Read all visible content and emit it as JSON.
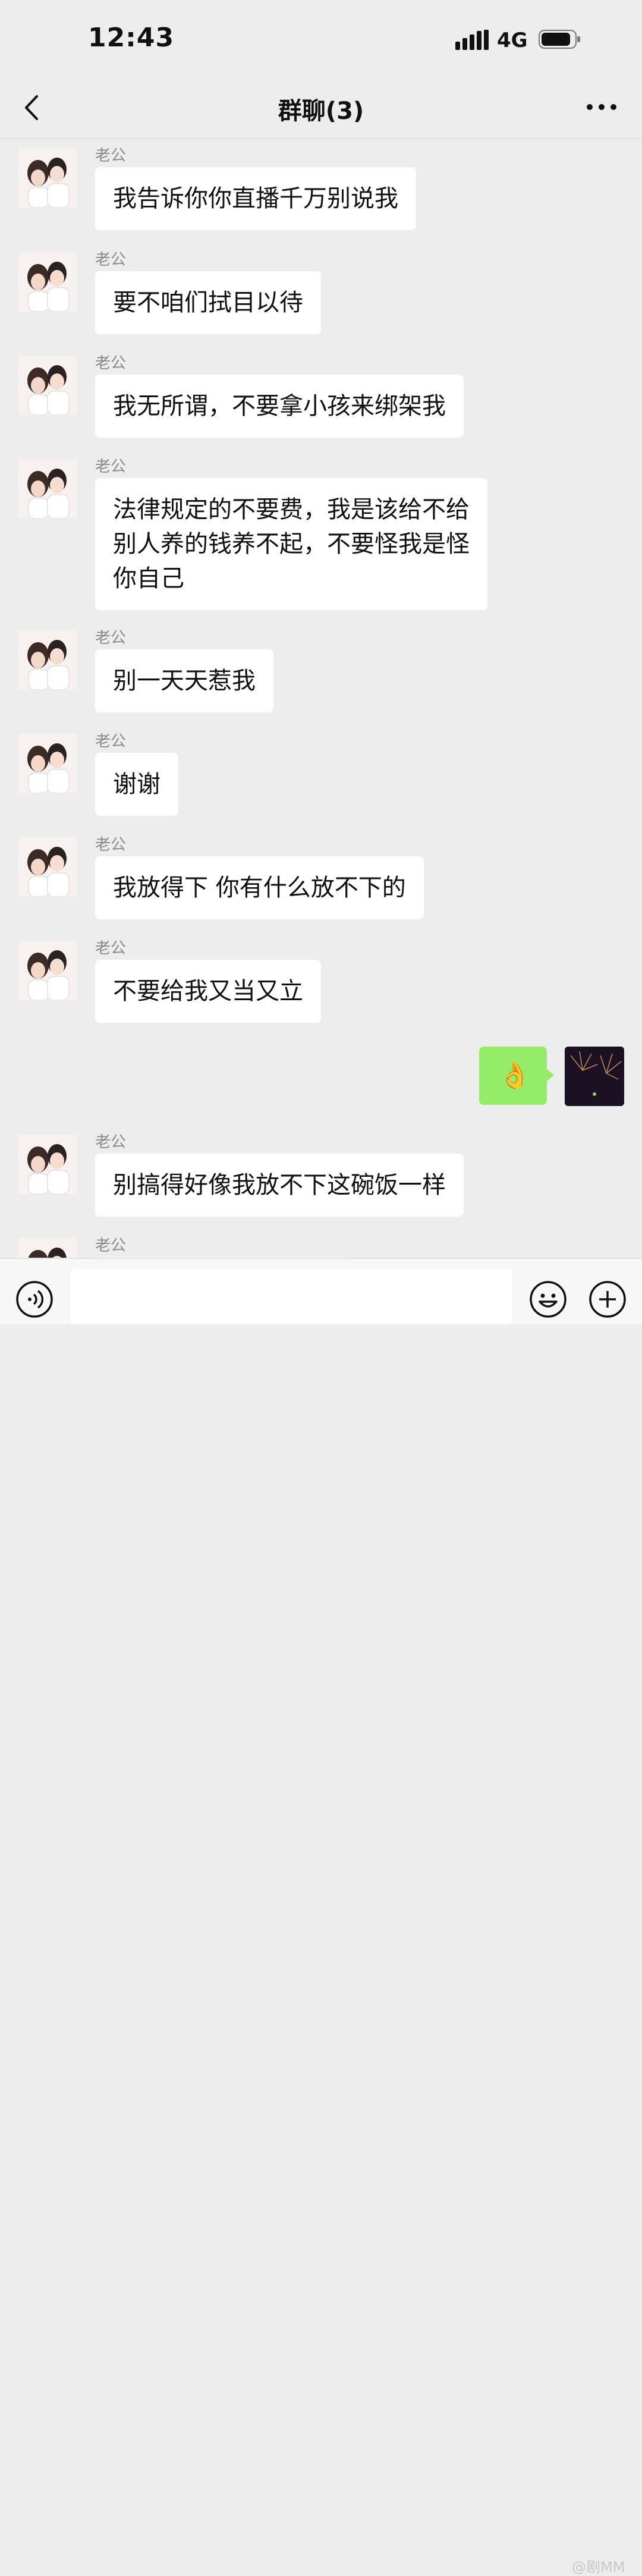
{
  "status": {
    "time": "12:43",
    "network": "4G"
  },
  "nav": {
    "title": "群聊(3)"
  },
  "messages": [
    {
      "sender": "老公",
      "text": "我告诉你你直播千万别说我"
    },
    {
      "sender": "老公",
      "text": "要不咱们拭目以待"
    },
    {
      "sender": "老公",
      "text": "我无所谓，不要拿小孩来绑架我"
    },
    {
      "sender": "老公",
      "text": "法律规定的不要费，我是该给不给别人养的钱养不起，不要怪我是怪你自己"
    },
    {
      "sender": "老公",
      "text": "别一天天惹我"
    },
    {
      "sender": "老公",
      "text": "谢谢"
    },
    {
      "sender": "老公",
      "text": "我放得下 你有什么放不下的"
    },
    {
      "sender": "老公",
      "text": "不要给我又当又立"
    },
    {
      "sender": "老公",
      "text": "别搞得好像我放不下这碗饭一样"
    },
    {
      "sender": "老公",
      "text": ""
    }
  ],
  "my_message": {
    "emoji": "👌"
  },
  "watermark": "@剧MM",
  "icons": {
    "back": "back-chevron-icon",
    "more": "more-dots-icon",
    "voice": "voice-icon",
    "emoji": "emoji-icon",
    "plus": "plus-icon"
  },
  "colors": {
    "background": "#ededed",
    "bubble_other": "#ffffff",
    "bubble_mine": "#95ec69"
  }
}
